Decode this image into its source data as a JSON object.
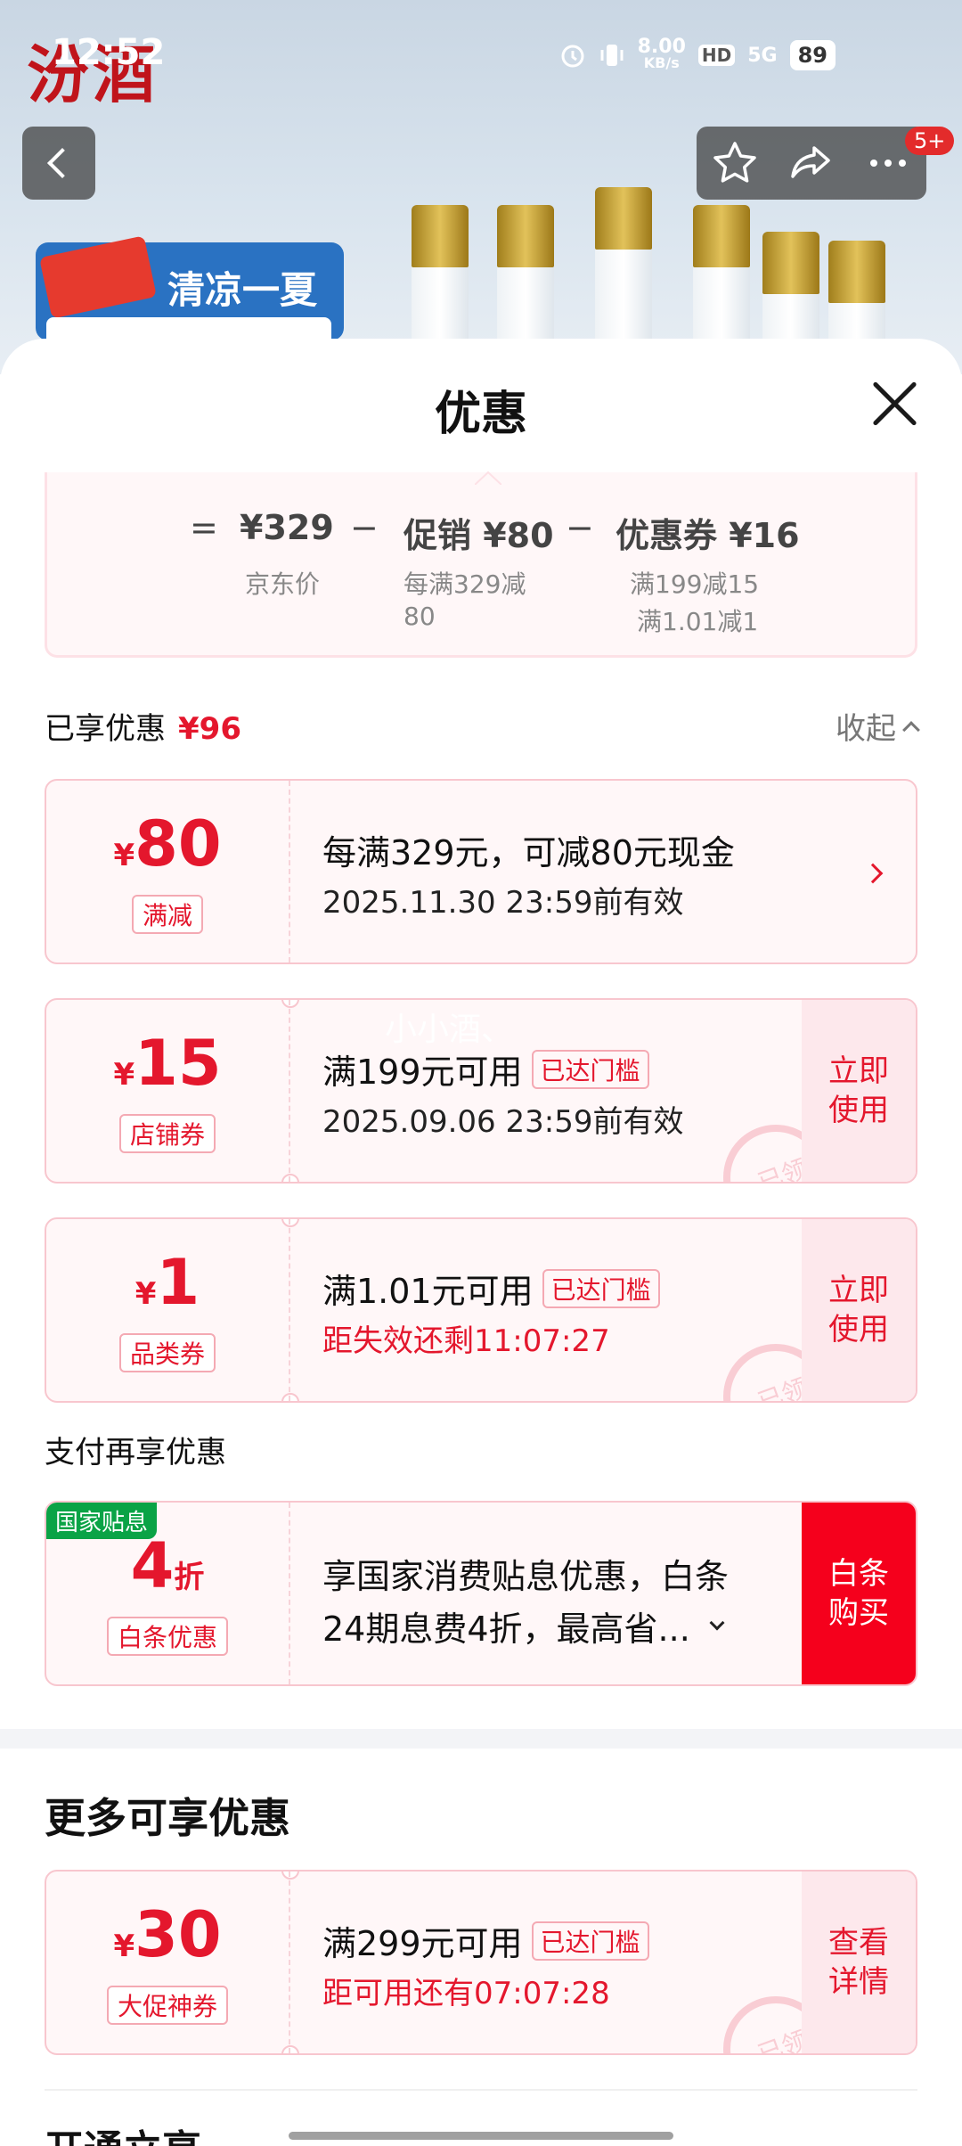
{
  "status_bar": {
    "time": "12:52",
    "net_speed_value": "8.00",
    "net_speed_unit": "KB/s",
    "hd": "HD",
    "signal": "5G",
    "battery": "89"
  },
  "product": {
    "brand": "汾酒",
    "banner_text": "清凉一夏",
    "more_badge": "5+"
  },
  "sheet": {
    "title": "优惠",
    "formula": {
      "eq": "=",
      "price": "¥329",
      "price_label": "京东价",
      "minus1": "−",
      "promo": "促销 ¥80",
      "promo_desc_1": "每满329减",
      "promo_desc_2": "80",
      "minus2": "−",
      "coupon": "优惠券 ¥16",
      "coupon_desc_1": "满199减15",
      "coupon_desc_2": "满1.01减1"
    },
    "enjoyed": {
      "label": "已享优惠",
      "amount": "¥96",
      "collapse": "收起"
    },
    "coupons": [
      {
        "currency": "¥",
        "amount": "80",
        "tag": "满减",
        "line1": "每满329元，可减80元现金",
        "line2": "2025.11.30 23:59前有效"
      },
      {
        "currency": "¥",
        "amount": "15",
        "tag": "店铺券",
        "line1": "满199元可用",
        "pill": "已达门槛",
        "line2": "2025.09.06 23:59前有效",
        "action_1": "立即",
        "action_2": "使用",
        "stamp": "已领",
        "watermark": "小小酒、"
      },
      {
        "currency": "¥",
        "amount": "1",
        "tag": "品类券",
        "line1": "满1.01元可用",
        "pill": "已达门槛",
        "line2": "距失效还剩11:07:27",
        "action_1": "立即",
        "action_2": "使用",
        "stamp": "已领"
      }
    ],
    "pay": {
      "title": "支付再享优惠",
      "badge": "国家贴息",
      "amount": "4",
      "unit": "折",
      "tag": "白条优惠",
      "line1": "享国家消费贴息优惠，白条",
      "line2": "24期息费4折，最高省...",
      "action_1": "白条",
      "action_2": "购买"
    },
    "more": {
      "title": "更多可享优惠",
      "coupon": {
        "currency": "¥",
        "amount": "30",
        "tag": "大促神券",
        "line1": "满299元可用",
        "pill": "已达门槛",
        "line2": "距可用还有07:07:28",
        "action_1": "查看",
        "action_2": "详情",
        "stamp": "已领"
      }
    },
    "next_title": "开通立享"
  }
}
